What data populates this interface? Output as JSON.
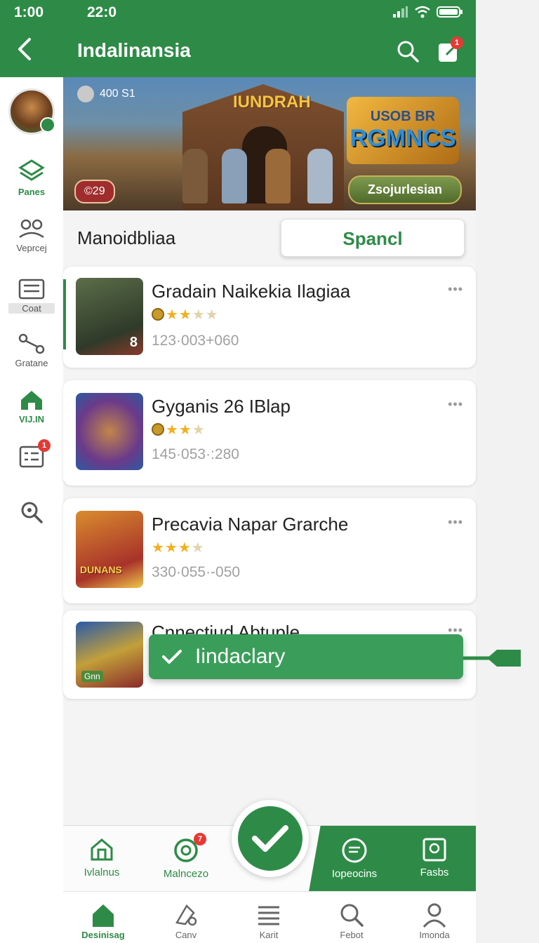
{
  "rail": {
    "time": "1:00",
    "items": [
      {
        "label": "Panes"
      },
      {
        "label": "Veprcej"
      },
      {
        "label": "Coat"
      },
      {
        "label": "Gratane"
      },
      {
        "label": "VIJ.IN"
      },
      {
        "label": "",
        "badge": "1"
      },
      {
        "label": ""
      }
    ]
  },
  "status": {
    "time": "22:0"
  },
  "appbar": {
    "title": "Indalinansia",
    "notif_badge": "1"
  },
  "hero": {
    "count": "400 S1",
    "sign": "IUNDRAH",
    "logo_line1": "USOB BR",
    "logo_line2": "RGMNCS",
    "rating": "©29",
    "cta": "Zsojurlesian"
  },
  "section": {
    "title": "Manoidbliaa",
    "button": "Spancl"
  },
  "cards": [
    {
      "title": "Gradain Naikekia Ilagiaa",
      "meta": "123·003+060",
      "thumb_badge": "8",
      "stars_on": 2
    },
    {
      "title": "Gyganis 26 IBlap",
      "meta": "145·053·:280",
      "stars_on": 2
    },
    {
      "title": "Precavia Napar Grarche",
      "meta": "330·055·-050",
      "thumb_text": "DUNANS",
      "stars_on": 3
    },
    {
      "title": "Cnnectiud Abtuple",
      "thumb_text": "Gnn"
    }
  ],
  "toast": {
    "text": "Iindaclary"
  },
  "bottom_actions": {
    "items": [
      {
        "label": "Ivlalnus"
      },
      {
        "label": "Malncezo",
        "badge": "7"
      },
      {
        "label": "Iopeocins"
      },
      {
        "label": "Fasbs"
      }
    ]
  },
  "bottom_nav": {
    "items": [
      {
        "label": "Desinisag"
      },
      {
        "label": "Canv"
      },
      {
        "label": "Karit"
      },
      {
        "label": "Febot"
      },
      {
        "label": "Imonda"
      }
    ]
  },
  "colors": {
    "primary": "#2e8b47",
    "toast": "#3a9e5a",
    "badge": "#e53935",
    "star": "#f2b01e"
  }
}
